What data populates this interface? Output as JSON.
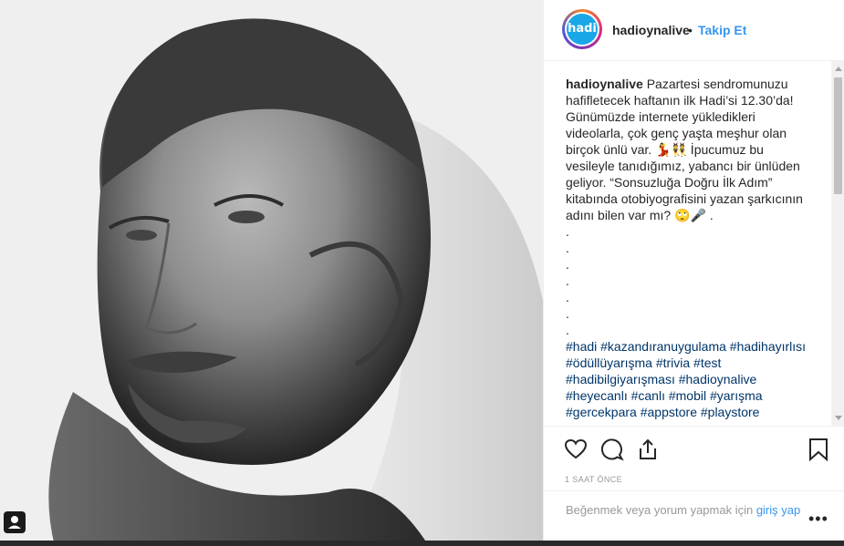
{
  "post": {
    "username": "hadioynalive",
    "dot": "•",
    "follow_label": "Takip Et",
    "avatar_text": "hadi",
    "caption_text": "Pazartesi sendromunuzu hafifletecek haftanın ilk Hadi’si 12.30’da! Günümüzde internete yükledikleri videolarla, çok genç yaşta meşhur olan birçok ünlü var. 💃👯 İpucumuz bu vesileyle tanıdığımız, yabancı bir ünlüden geliyor. “Sonsuzluğa Doğru İlk Adım” kitabında otobiyografisini yazan şarkıcının adını bilen var mı? 🙄🎤 .\n.\n.\n.\n.\n.\n.\n.\n",
    "hashtags": "#hadi #kazandıranuygulama #hadihayırlısı #ödüllüyarışma #trivia #test #hadibilgiyarışması #hadioynalive #heyecanlı #canlı #mobil #yarışma #gercekpara #appstore #playstore",
    "time": "1 SAAT ÖNCE",
    "login_text": "Beğenmek veya yorum yapmak için ",
    "login_link": "giriş yap",
    "more_label": "•••"
  },
  "icons": {
    "like": "heart-icon",
    "comment": "comment-icon",
    "share": "share-icon",
    "save": "bookmark-icon",
    "user_tag": "user-tag-icon"
  },
  "colors": {
    "accent": "#3897f0",
    "hashtag": "#003569",
    "text": "#262626",
    "muted": "#999999"
  }
}
